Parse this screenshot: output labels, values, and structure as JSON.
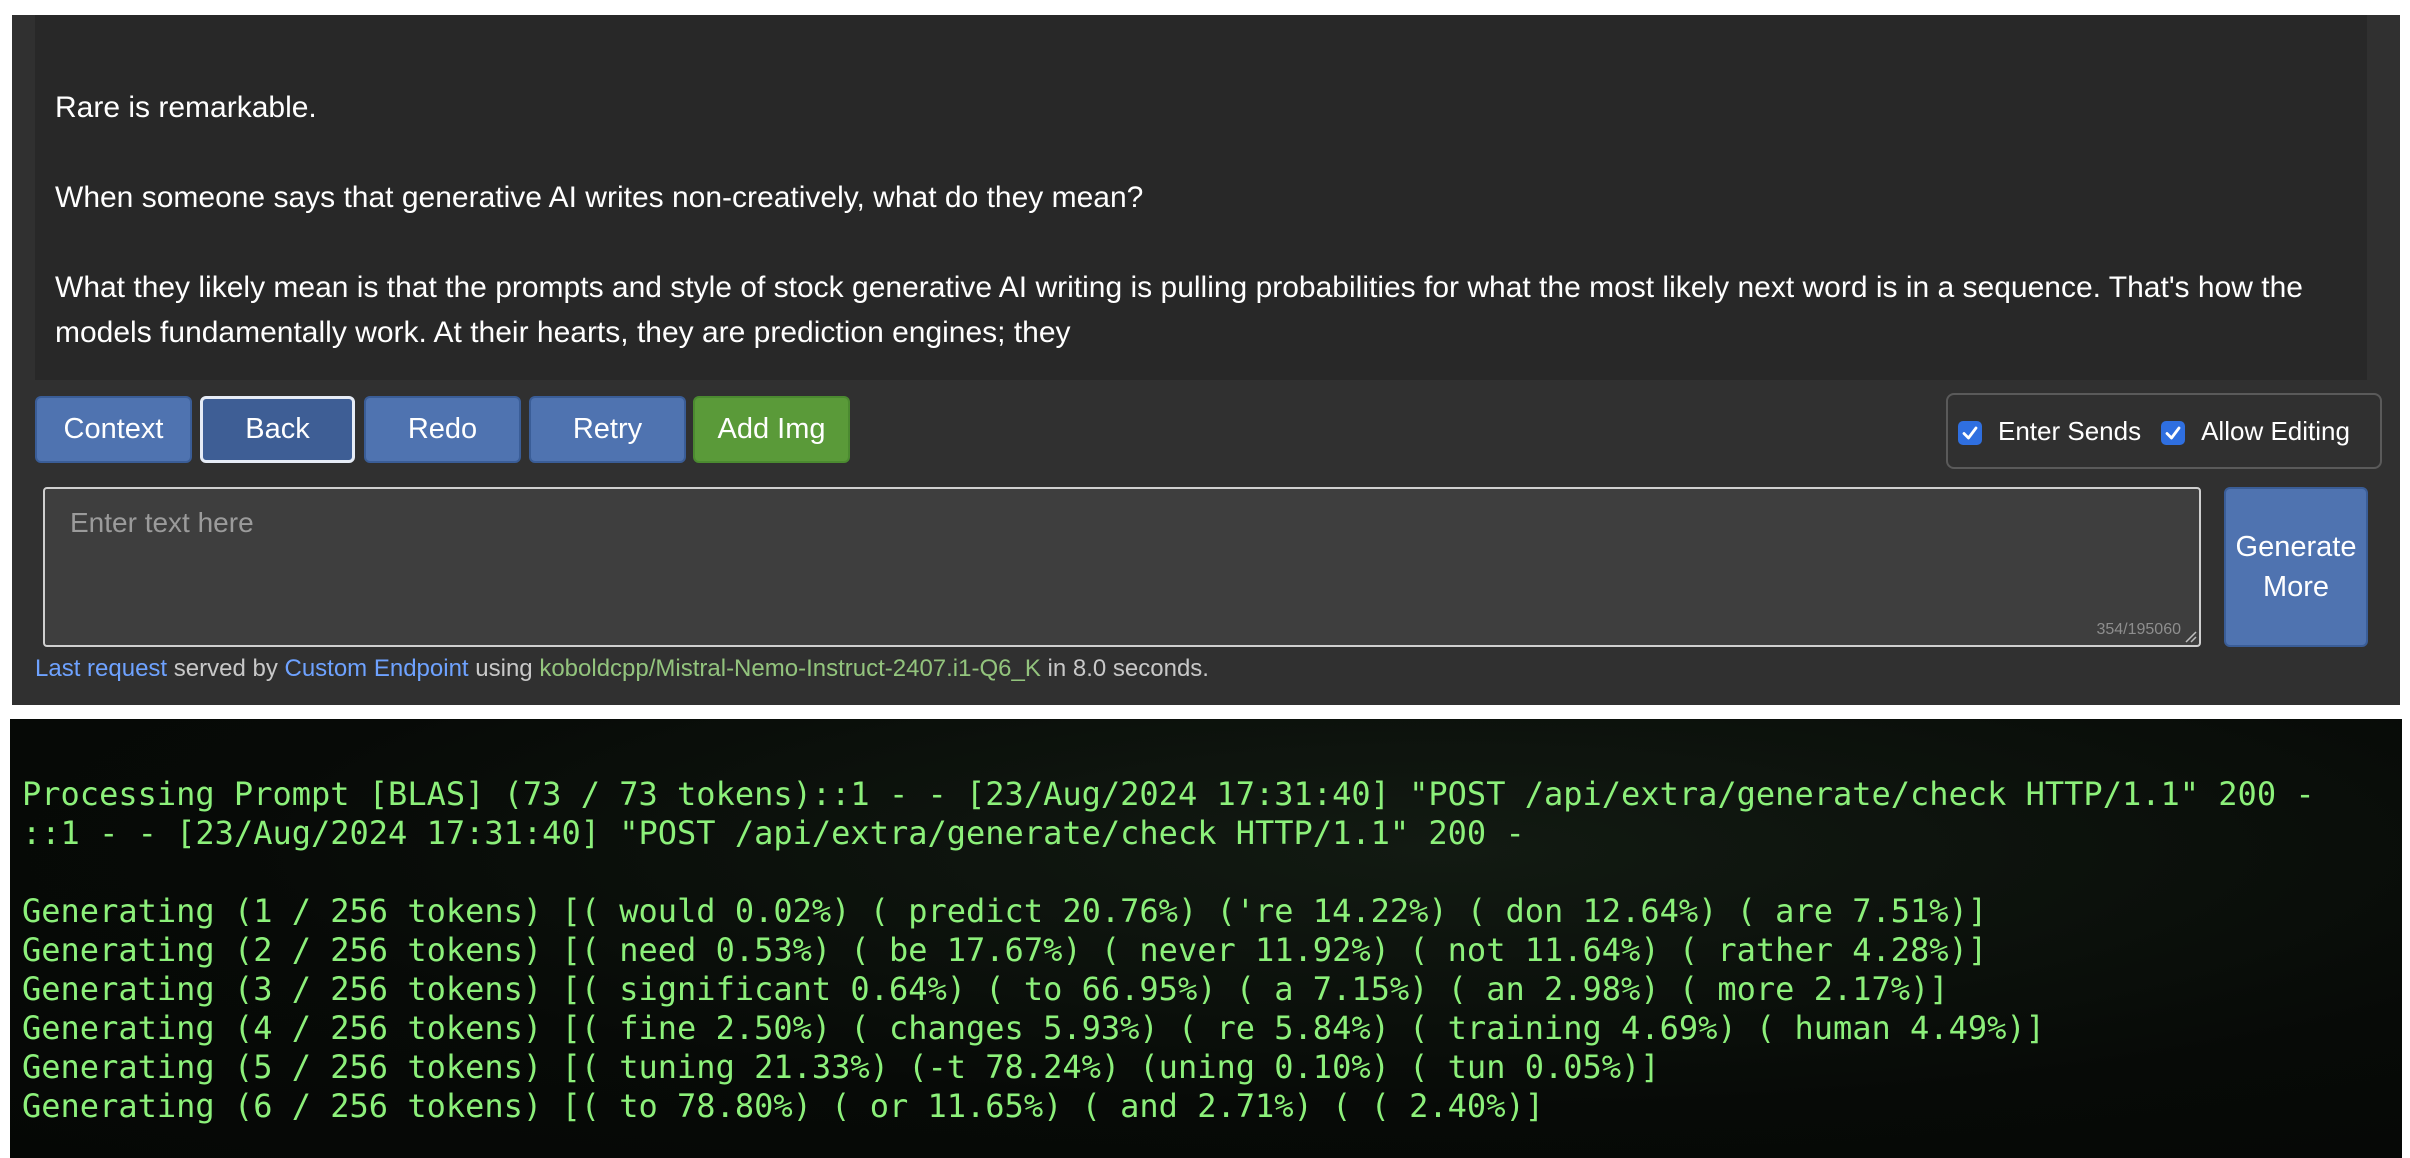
{
  "story": {
    "paragraphs": [
      "Rare is remarkable.",
      "When someone says that generative AI writes non-creatively, what do they mean?",
      "What they likely mean is that the prompts and style of stock generative AI writing is pulling probabilities for what the most likely next word is in a sequence. That's how the models fundamentally work. At their hearts, they are prediction engines; they"
    ]
  },
  "toolbar": {
    "context_label": "Context",
    "back_label": "Back",
    "redo_label": "Redo",
    "retry_label": "Retry",
    "add_img_label": "Add Img"
  },
  "options": {
    "enter_sends_label": "Enter Sends",
    "enter_sends_checked": true,
    "allow_editing_label": "Allow Editing",
    "allow_editing_checked": true
  },
  "input": {
    "placeholder": "Enter text here",
    "value": "",
    "char_count": "354/195060"
  },
  "generate": {
    "line1": "Generate",
    "line2": "More"
  },
  "status": {
    "last_request": "Last request",
    "served_by": " served by ",
    "endpoint": "Custom Endpoint",
    "using": " using ",
    "model": "koboldcpp/Mistral-Nemo-Instruct-2407.i1-Q6_K",
    "duration": " in 8.0 seconds."
  },
  "colors": {
    "accent_blue": "#4f73b0",
    "accent_green": "#5a9a39",
    "terminal_text": "#8cf07a"
  },
  "terminal": {
    "lines": [
      "Processing Prompt [BLAS] (73 / 73 tokens)::1 - - [23/Aug/2024 17:31:40] \"POST /api/extra/generate/check HTTP/1.1\" 200 -",
      "::1 - - [23/Aug/2024 17:31:40] \"POST /api/extra/generate/check HTTP/1.1\" 200 -",
      "",
      "Generating (1 / 256 tokens) [( would 0.02%) ( predict 20.76%) ('re 14.22%) ( don 12.64%) ( are 7.51%)]",
      "Generating (2 / 256 tokens) [( need 0.53%) ( be 17.67%) ( never 11.92%) ( not 11.64%) ( rather 4.28%)]",
      "Generating (3 / 256 tokens) [( significant 0.64%) ( to 66.95%) ( a 7.15%) ( an 2.98%) ( more 2.17%)]",
      "Generating (4 / 256 tokens) [( fine 2.50%) ( changes 5.93%) ( re 5.84%) ( training 4.69%) ( human 4.49%)]",
      "Generating (5 / 256 tokens) [( tuning 21.33%) (-t 78.24%) (uning 0.10%) ( tun 0.05%)]",
      "Generating (6 / 256 tokens) [( to 78.80%) ( or 11.65%) ( and 2.71%) ( ( 2.40%)]"
    ]
  }
}
